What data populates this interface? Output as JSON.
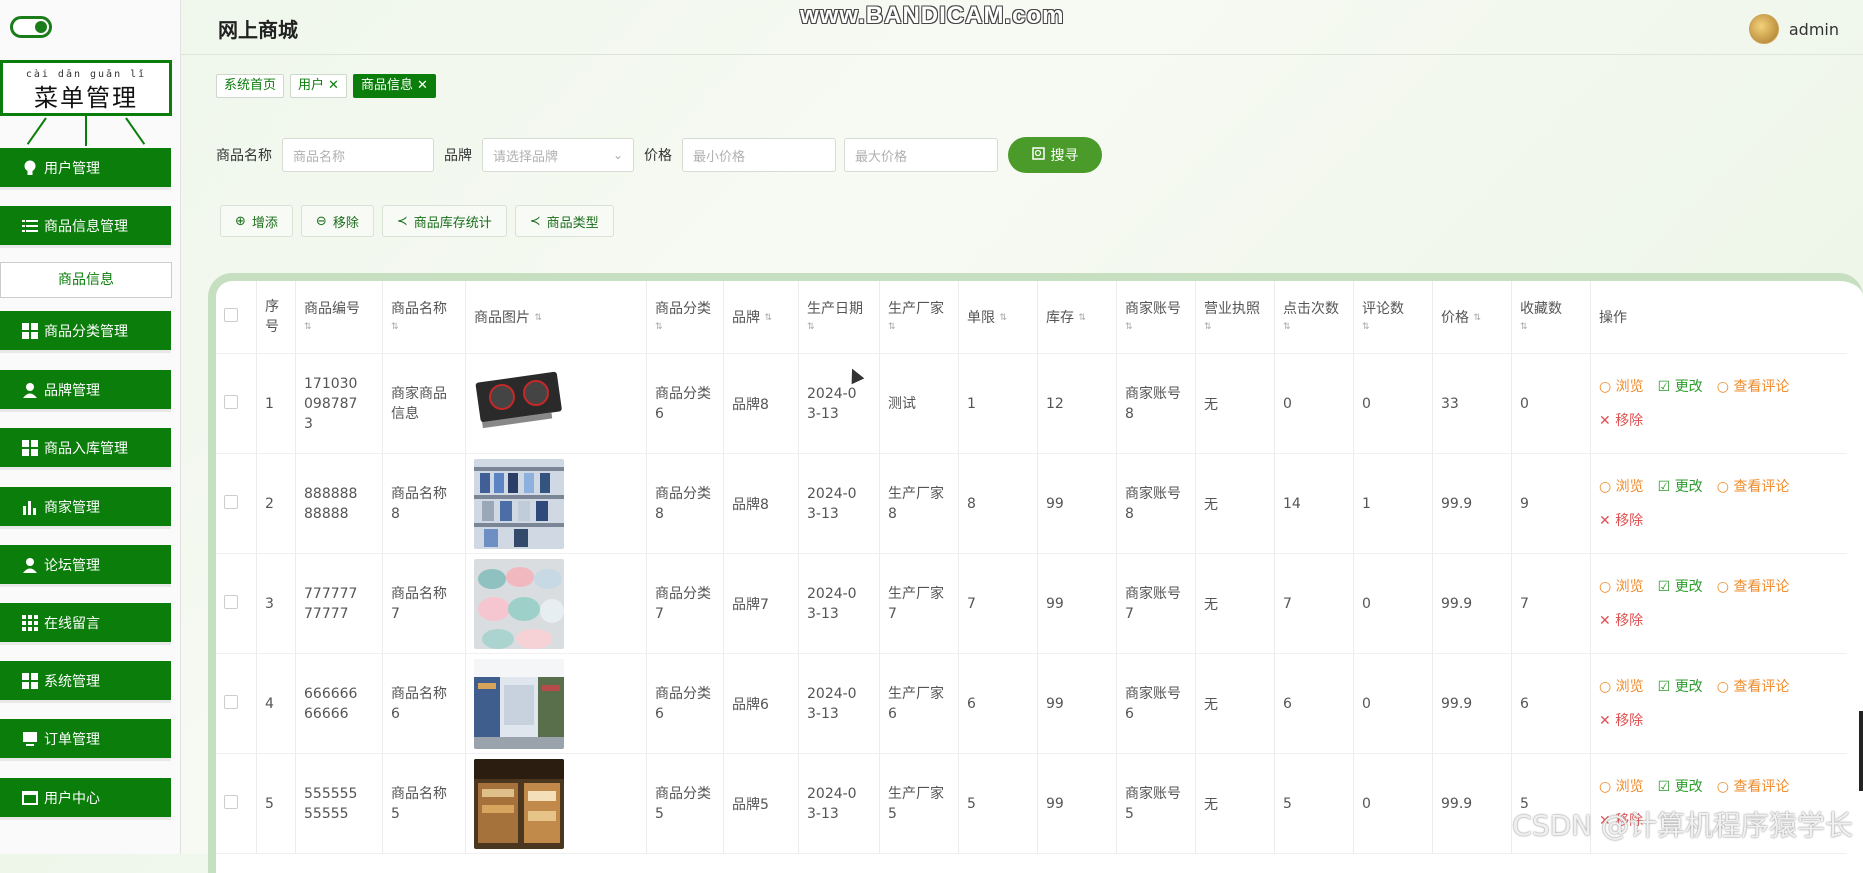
{
  "sidebar": {
    "menu_title_pinyin": "cài dān guǎn lǐ",
    "menu_title": "菜单管理",
    "items": [
      {
        "label": "用户管理",
        "icon": "lightbulb-icon"
      },
      {
        "label": "商品信息管理",
        "icon": "list-icon"
      },
      {
        "label": "商品分类管理",
        "icon": "grid-icon"
      },
      {
        "label": "品牌管理",
        "icon": "user-icon"
      },
      {
        "label": "商品入库管理",
        "icon": "grid-icon"
      },
      {
        "label": "商家管理",
        "icon": "bar-chart-icon"
      },
      {
        "label": "论坛管理",
        "icon": "user-icon"
      },
      {
        "label": "在线留言",
        "icon": "grid-icon"
      },
      {
        "label": "系统管理",
        "icon": "grid-icon"
      },
      {
        "label": "订单管理",
        "icon": "monitor-icon"
      },
      {
        "label": "用户中心",
        "icon": "window-icon"
      }
    ],
    "sub_item": "商品信息"
  },
  "header": {
    "title": "网上商城",
    "watermark": "www.BANDICAM.com",
    "user": "admin"
  },
  "tags": [
    {
      "label": "系统首页",
      "active": false
    },
    {
      "label": "用户",
      "active": false
    },
    {
      "label": "商品信息",
      "active": true
    }
  ],
  "search": {
    "name_label": "商品名称",
    "name_placeholder": "商品名称",
    "brand_label": "品牌",
    "brand_placeholder": "请选择品牌",
    "price_label": "价格",
    "min_placeholder": "最小价格",
    "max_placeholder": "最大价格",
    "button": "搜寻"
  },
  "actions": {
    "add": "增添",
    "remove": "移除",
    "stock_stats": "商品库存统计",
    "type_stats": "商品类型"
  },
  "table": {
    "headers": [
      "序号",
      "商品编号",
      "商品名称",
      "商品图片",
      "商品分类",
      "品牌",
      "生产日期",
      "生产厂家",
      "单限",
      "库存",
      "商家账号",
      "营业执照",
      "点击次数",
      "评论数",
      "价格",
      "收藏数",
      "操作"
    ],
    "row_actions": {
      "view": "浏览",
      "edit": "更改",
      "comments": "查看评论",
      "delete": "移除"
    },
    "rows": [
      {
        "no": "1",
        "code": "1710300987873",
        "name": "商家商品信息",
        "category": "商品分类6",
        "brand": "品牌8",
        "date": "2024-03-13",
        "maker": "测试",
        "limit": "1",
        "stock": "12",
        "merchant": "商家账号8",
        "license": "无",
        "clicks": "0",
        "comments": "0",
        "price": "33",
        "favs": "0",
        "img": "gpu"
      },
      {
        "no": "2",
        "code": "88888888888",
        "name": "商品名称8",
        "category": "商品分类8",
        "brand": "品牌8",
        "date": "2024-03-13",
        "maker": "生产厂家8",
        "limit": "8",
        "stock": "99",
        "merchant": "商家账号8",
        "license": "无",
        "clicks": "14",
        "comments": "1",
        "price": "99.9",
        "favs": "9",
        "img": "shelf"
      },
      {
        "no": "3",
        "code": "77777777777",
        "name": "商品名称7",
        "category": "商品分类7",
        "brand": "品牌7",
        "date": "2024-03-13",
        "maker": "生产厂家7",
        "limit": "7",
        "stock": "99",
        "merchant": "商家账号7",
        "license": "无",
        "clicks": "7",
        "comments": "0",
        "price": "99.9",
        "favs": "7",
        "img": "bowls"
      },
      {
        "no": "4",
        "code": "66666666666",
        "name": "商品名称6",
        "category": "商品分类6",
        "brand": "品牌6",
        "date": "2024-03-13",
        "maker": "生产厂家6",
        "limit": "6",
        "stock": "99",
        "merchant": "商家账号6",
        "license": "无",
        "clicks": "6",
        "comments": "0",
        "price": "99.9",
        "favs": "6",
        "img": "aisle"
      },
      {
        "no": "5",
        "code": "55555555555",
        "name": "商品名称5",
        "category": "商品分类5",
        "brand": "品牌5",
        "date": "2024-03-13",
        "maker": "生产厂家5",
        "limit": "5",
        "stock": "99",
        "merchant": "商家账号5",
        "license": "无",
        "clicks": "5",
        "comments": "0",
        "price": "99.9",
        "favs": "5",
        "img": "store"
      }
    ]
  },
  "overlay_watermark": "CSDN @计算机程序猿学长",
  "colors": {
    "primary": "#0a7d0a",
    "search": "#4a9b2a",
    "view": "#f08c2c",
    "edit": "#2c9c2c",
    "delete": "#e05252"
  }
}
